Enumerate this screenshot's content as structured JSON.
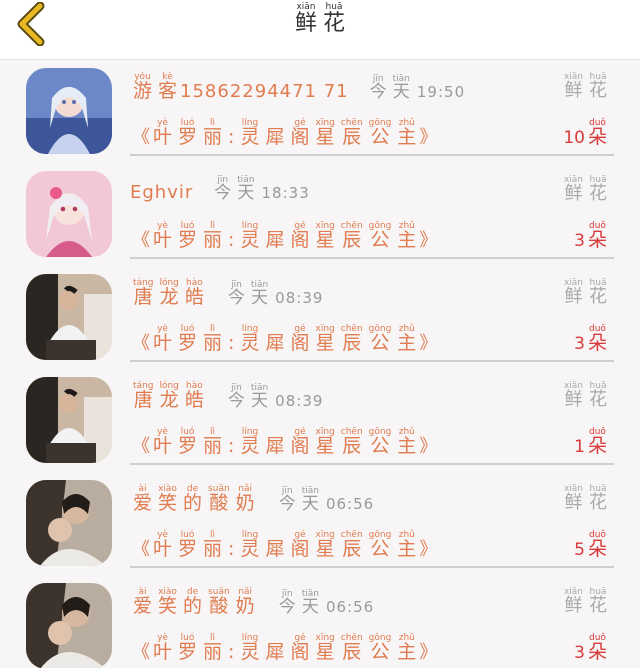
{
  "header": {
    "title": [
      {
        "py": "xiān",
        "hz": "鲜"
      },
      {
        "py": "huā",
        "hz": "花"
      }
    ],
    "back_icon": "chevron-left-icon",
    "accent": "#e8b923"
  },
  "flower_label": [
    {
      "py": "xiān",
      "hz": "鲜"
    },
    {
      "py": "huā",
      "hz": "花"
    }
  ],
  "today": [
    {
      "py": "jīn",
      "hz": "今"
    },
    {
      "py": "tiān",
      "hz": "天"
    }
  ],
  "gift_name": {
    "open": "《",
    "close": "》",
    "chars": [
      {
        "py": "yè",
        "hz": "叶"
      },
      {
        "py": "luó",
        "hz": "罗"
      },
      {
        "py": "lì",
        "hz": "丽"
      },
      {
        "py": "",
        "hz": ":"
      },
      {
        "py": "líng",
        "hz": "灵"
      },
      {
        "py": "",
        "hz": "犀"
      },
      {
        "py": "gé",
        "hz": "阁"
      },
      {
        "py": "xīng",
        "hz": "星"
      },
      {
        "py": "chēn",
        "hz": "辰"
      },
      {
        "py": "gōng",
        "hz": "公"
      },
      {
        "py": "zhǔ",
        "hz": "主"
      }
    ]
  },
  "unit": {
    "py": "duǒ",
    "hz": "朵"
  },
  "colors": {
    "name": "#e07c4f",
    "count": "#d93a3a",
    "muted": "#a9a9a9",
    "divider": "#cfcfcf"
  },
  "records": [
    {
      "avatar": "avatar-anime-girl-blue",
      "sender_chars": [
        {
          "py": "yóu",
          "hz": "游"
        },
        {
          "py": "kè",
          "hz": "客"
        }
      ],
      "sender_latin": "15862294471 71",
      "time": "19:50",
      "count": "10"
    },
    {
      "avatar": "avatar-anime-girl-pink",
      "sender_chars": [],
      "sender_latin": "Eghvir",
      "time": "18:33",
      "count": "3"
    },
    {
      "avatar": "avatar-man-photo",
      "sender_chars": [
        {
          "py": "táng",
          "hz": "唐"
        },
        {
          "py": "lóng",
          "hz": "龙"
        },
        {
          "py": "hào",
          "hz": "皓"
        }
      ],
      "sender_latin": "",
      "time": "08:39",
      "count": "3"
    },
    {
      "avatar": "avatar-man-photo",
      "sender_chars": [
        {
          "py": "táng",
          "hz": "唐"
        },
        {
          "py": "lóng",
          "hz": "龙"
        },
        {
          "py": "hào",
          "hz": "皓"
        }
      ],
      "sender_latin": "",
      "time": "08:39",
      "count": "1"
    },
    {
      "avatar": "avatar-couple-photo",
      "sender_chars": [
        {
          "py": "ài",
          "hz": "爱"
        },
        {
          "py": "xiào",
          "hz": "笑"
        },
        {
          "py": "de",
          "hz": "的"
        },
        {
          "py": "suān",
          "hz": "酸"
        },
        {
          "py": "nǎi",
          "hz": "奶"
        }
      ],
      "sender_latin": "",
      "time": "06:56",
      "count": "5"
    },
    {
      "avatar": "avatar-couple-photo",
      "sender_chars": [
        {
          "py": "ài",
          "hz": "爱"
        },
        {
          "py": "xiào",
          "hz": "笑"
        },
        {
          "py": "de",
          "hz": "的"
        },
        {
          "py": "suān",
          "hz": "酸"
        },
        {
          "py": "nǎi",
          "hz": "奶"
        }
      ],
      "sender_latin": "",
      "time": "06:56",
      "count": "3"
    }
  ]
}
